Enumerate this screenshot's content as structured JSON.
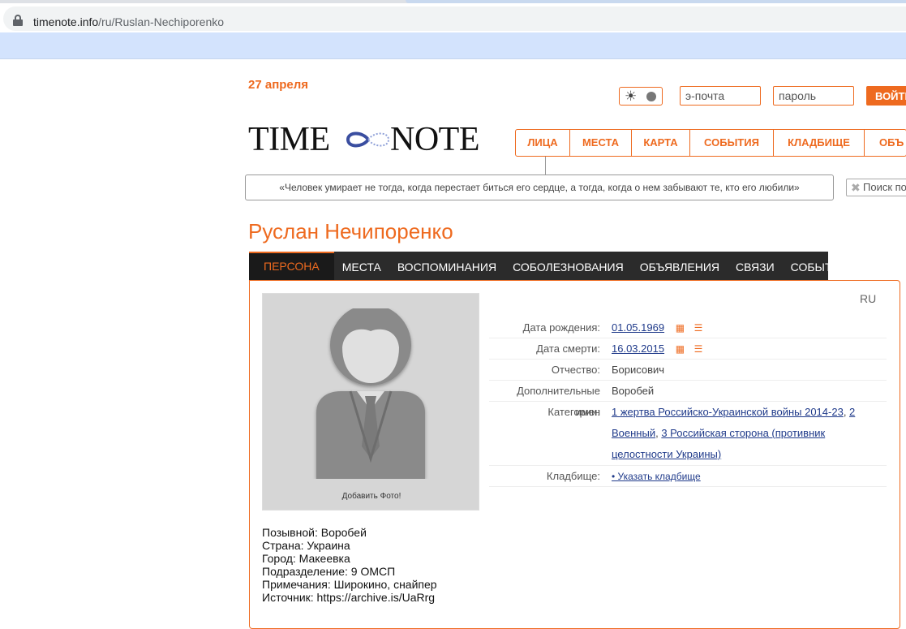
{
  "browser": {
    "url_host": "timenote.info",
    "url_path": "/ru/Ruslan-Nechiporenko"
  },
  "header": {
    "date": "27 апреля",
    "theme_sun": "☀",
    "email_placeholder": "э-почта",
    "password_placeholder": "пароль",
    "login_label": "ВОЙТИ",
    "logo_left": "TIME",
    "logo_right": "NOTE",
    "nav": [
      "ЛИЦА",
      "МЕСТА",
      "КАРТА",
      "СОБЫТИЯ",
      "КЛАДБИЩЕ",
      "ОБЪ"
    ],
    "quote": "«Человек умирает не тогда, когда перестает биться его сердце, а тогда, когда о нем забывают те, кто его любили»",
    "search_placeholder": "Поиск по"
  },
  "person": {
    "name": "Руслан Нечипоренко",
    "tabs": [
      "ПЕРСОНА",
      "МЕСТА",
      "ВОСПОМИНАНИЯ",
      "СОБОЛЕЗНОВАНИЯ",
      "ОБЪЯВЛЕНИЯ",
      "СВЯЗИ",
      "СОБЫТИЯ"
    ],
    "lang": "RU",
    "add_photo": "Добавить Фото!",
    "fields": {
      "birth_label": "Дата рождения:",
      "birth_value": "01.05.1969",
      "death_label": "Дата смерти:",
      "death_value": "16.03.2015",
      "patronymic_label": "Отчество:",
      "patronymic_value": "Борисович",
      "extra_names_label": "Дополнительные имен",
      "extra_names_value": "Воробей",
      "categories_label": "Категории:",
      "categories": [
        "1 жертва Российско-Украинской войны 2014-23",
        "2 Военный",
        "3 Российская сторона (противник целостности Украины)"
      ],
      "cemetery_label": "Кладбище:",
      "cemetery_value": "• Указать кладбище"
    },
    "bio": [
      "Позывной: Воробей",
      "Страна: Украина",
      "Город: Макеевка",
      "Подразделение: 9 ОМСП",
      "Примечания: Широкино, снайпер",
      "Источник: https://archive.is/UaRrg"
    ]
  },
  "colors": {
    "accent": "#ee6a1f",
    "dark_nav": "#2b2b2b",
    "link": "#1f3a8a"
  }
}
